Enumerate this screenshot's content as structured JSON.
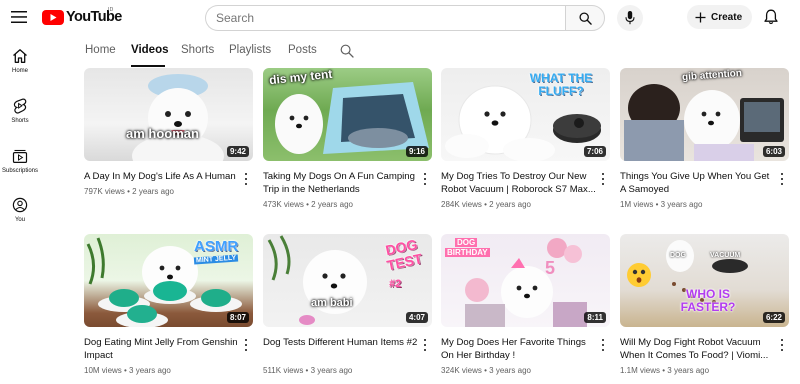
{
  "header": {
    "logo_text": "YouTube",
    "country_code": "ID",
    "search_placeholder": "Search",
    "create_label": "Create"
  },
  "sidebar": {
    "items": [
      {
        "label": "Home",
        "icon": "home-icon"
      },
      {
        "label": "Shorts",
        "icon": "shorts-icon"
      },
      {
        "label": "Subscriptions",
        "icon": "subscriptions-icon"
      },
      {
        "label": "You",
        "icon": "you-icon"
      }
    ]
  },
  "tabs": [
    {
      "label": "Home",
      "active": false
    },
    {
      "label": "Videos",
      "active": true
    },
    {
      "label": "Shorts",
      "active": false
    },
    {
      "label": "Playlists",
      "active": false
    },
    {
      "label": "Posts",
      "active": false
    }
  ],
  "videos": [
    {
      "title": "A Day In My Dog's Life As A Human",
      "views": "797K views",
      "age": "2 years ago",
      "duration": "9:42",
      "overlay": "am hooman"
    },
    {
      "title": "Taking My Dogs On A Fun Camping Trip in the Netherlands",
      "views": "473K views",
      "age": "2 years ago",
      "duration": "9:16",
      "overlay": "dis my tent"
    },
    {
      "title": "My Dog Tries To Destroy Our New Robot Vacuum | Roborock S7 Max...",
      "views": "284K views",
      "age": "2 years ago",
      "duration": "7:06",
      "overlay": "WHAT THE FLUFF?"
    },
    {
      "title": "Things You Give Up When You Get A Samoyed",
      "views": "1M views",
      "age": "3 years ago",
      "duration": "6:03",
      "overlay": "gib attention"
    },
    {
      "title": "Dog Eating Mint Jelly From Genshin Impact",
      "views": "10M views",
      "age": "3 years ago",
      "duration": "8:07",
      "overlay": "ASMR",
      "overlay2": "MINT JELLY"
    },
    {
      "title": "Dog Tests Different Human Items #2",
      "views": "511K views",
      "age": "3 years ago",
      "duration": "4:07",
      "overlay": "DOG TEST",
      "overlay2": "#2",
      "overlay3": "am babi"
    },
    {
      "title": "My Dog Does Her Favorite Things On Her Birthday !",
      "views": "324K views",
      "age": "3 years ago",
      "duration": "8:11",
      "overlay": "DOG",
      "overlay2": "BIRTHDAY"
    },
    {
      "title": "Will My Dog Fight Robot Vacuum When It Comes To Food? | Viomi...",
      "views": "1.1M views",
      "age": "3 years ago",
      "duration": "6:22",
      "overlay": "DOG",
      "overlay2": "VACUUM",
      "overlay3": "WHO IS FASTER?"
    }
  ],
  "colors": {
    "brand_red": "#ff0000",
    "text_primary": "#0f0f0f",
    "text_secondary": "#606060"
  }
}
